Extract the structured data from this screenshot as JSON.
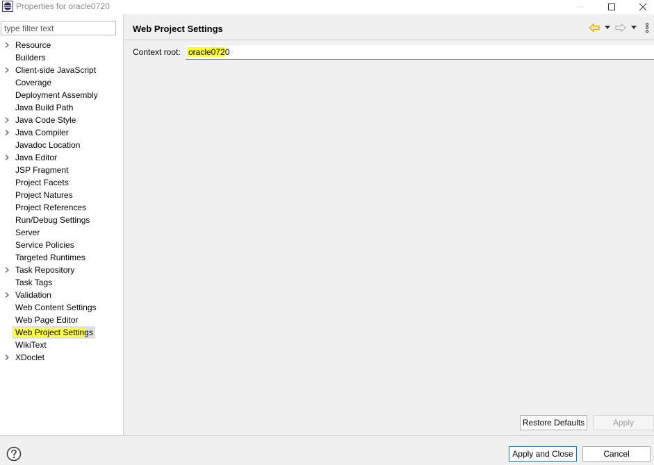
{
  "window": {
    "title": "Properties for oracle0720",
    "minimize_icon": "minimize-icon",
    "maximize_icon": "maximize-icon",
    "close_icon": "close-icon"
  },
  "filter": {
    "placeholder": "type filter text",
    "value": ""
  },
  "tree": {
    "items": [
      {
        "label": "Resource",
        "expandable": true
      },
      {
        "label": "Builders",
        "expandable": false
      },
      {
        "label": "Client-side JavaScript",
        "expandable": true
      },
      {
        "label": "Coverage",
        "expandable": false
      },
      {
        "label": "Deployment Assembly",
        "expandable": false
      },
      {
        "label": "Java Build Path",
        "expandable": false
      },
      {
        "label": "Java Code Style",
        "expandable": true
      },
      {
        "label": "Java Compiler",
        "expandable": true
      },
      {
        "label": "Javadoc Location",
        "expandable": false
      },
      {
        "label": "Java Editor",
        "expandable": true
      },
      {
        "label": "JSP Fragment",
        "expandable": false
      },
      {
        "label": "Project Facets",
        "expandable": false
      },
      {
        "label": "Project Natures",
        "expandable": false
      },
      {
        "label": "Project References",
        "expandable": false
      },
      {
        "label": "Run/Debug Settings",
        "expandable": false
      },
      {
        "label": "Server",
        "expandable": false
      },
      {
        "label": "Service Policies",
        "expandable": false
      },
      {
        "label": "Targeted Runtimes",
        "expandable": false
      },
      {
        "label": "Task Repository",
        "expandable": true
      },
      {
        "label": "Task Tags",
        "expandable": false
      },
      {
        "label": "Validation",
        "expandable": true
      },
      {
        "label": "Web Content Settings",
        "expandable": false
      },
      {
        "label": "Web Page Editor",
        "expandable": false
      },
      {
        "label": "Web Project Settings",
        "expandable": false,
        "selected": true
      },
      {
        "label": "WikiText",
        "expandable": false
      },
      {
        "label": "XDoclet",
        "expandable": true
      }
    ]
  },
  "page": {
    "title": "Web Project Settings",
    "context_root_label": "Context root:",
    "context_root_value_highlighted": "oracle072",
    "context_root_value_rest": "0"
  },
  "buttons": {
    "restore_defaults": "Restore Defaults",
    "apply": "Apply",
    "apply_and_close": "Apply and Close",
    "cancel": "Cancel"
  },
  "colors": {
    "highlight": "#ffff3a",
    "nav_arrow": "#e8a400",
    "primary_border": "#0078d7"
  }
}
